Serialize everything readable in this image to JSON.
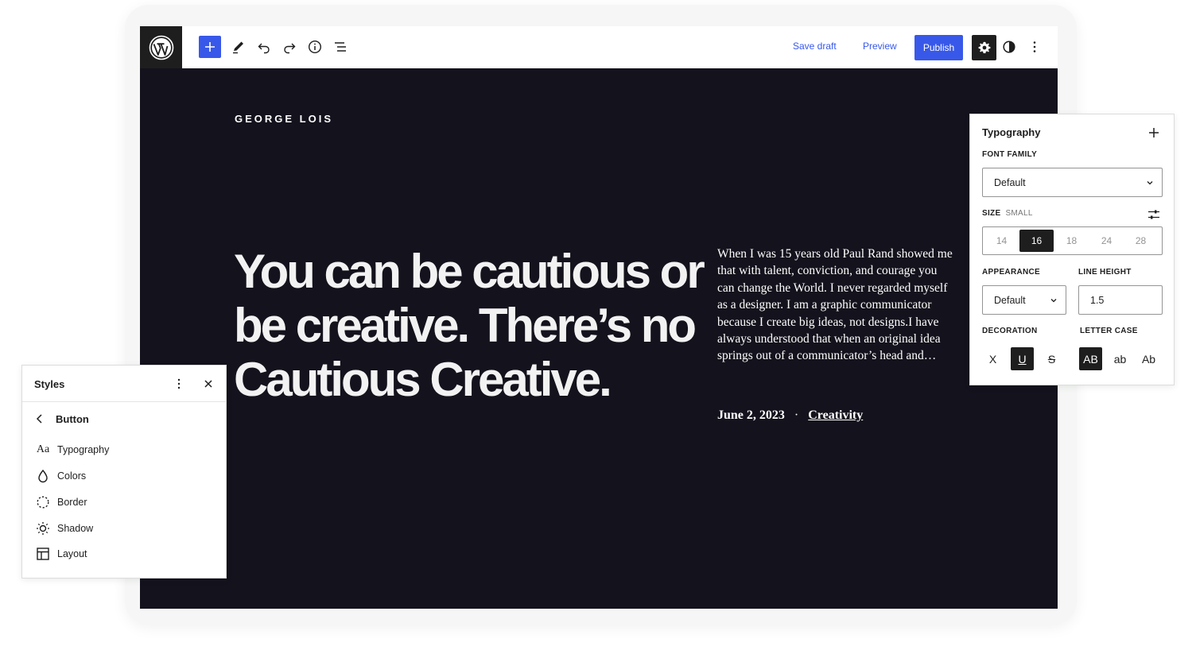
{
  "toolbar": {
    "save_draft": "Save draft",
    "preview": "Preview",
    "publish": "Publish"
  },
  "content": {
    "site_title": "GEORGE LOIS",
    "headline": "You can be cautious or be creative. There’s no Cautious Creative.",
    "excerpt": "When I was 15 years old Paul Rand showed me that with talent, conviction, and courage you can change the World. I never regarded myself as a designer. I am a graphic communicator because I create big ideas, not designs.I have always understood that when an original idea springs out of a communicator’s head and…",
    "date": "June 2, 2023",
    "separator": "·",
    "category": "Creativity"
  },
  "styles_panel": {
    "title": "Styles",
    "back_label": "Button",
    "items": [
      {
        "label": "Typography",
        "icon": "typography-icon"
      },
      {
        "label": "Colors",
        "icon": "droplet-icon"
      },
      {
        "label": "Border",
        "icon": "border-icon"
      },
      {
        "label": "Shadow",
        "icon": "shadow-icon"
      },
      {
        "label": "Layout",
        "icon": "layout-icon"
      }
    ]
  },
  "typography_panel": {
    "title": "Typography",
    "font_family_label": "FONT FAMILY",
    "font_family_value": "Default",
    "size_label": "SIZE",
    "size_current": "SMALL",
    "sizes": [
      "14",
      "16",
      "18",
      "24",
      "28"
    ],
    "size_selected": "16",
    "appearance_label": "APPEARANCE",
    "appearance_value": "Default",
    "line_height_label": "LINE HEIGHT",
    "line_height_value": "1.5",
    "decoration_label": "DECORATION",
    "letter_case_label": "LETTER CASE",
    "decoration_options": [
      "X",
      "U",
      "S"
    ],
    "decoration_selected": "U",
    "letter_case_options": [
      "AB",
      "ab",
      "Ab"
    ],
    "letter_case_selected": "AB"
  },
  "colors": {
    "accent": "#3858e9",
    "canvas": "#14121c",
    "dark": "#1e1e1e"
  }
}
